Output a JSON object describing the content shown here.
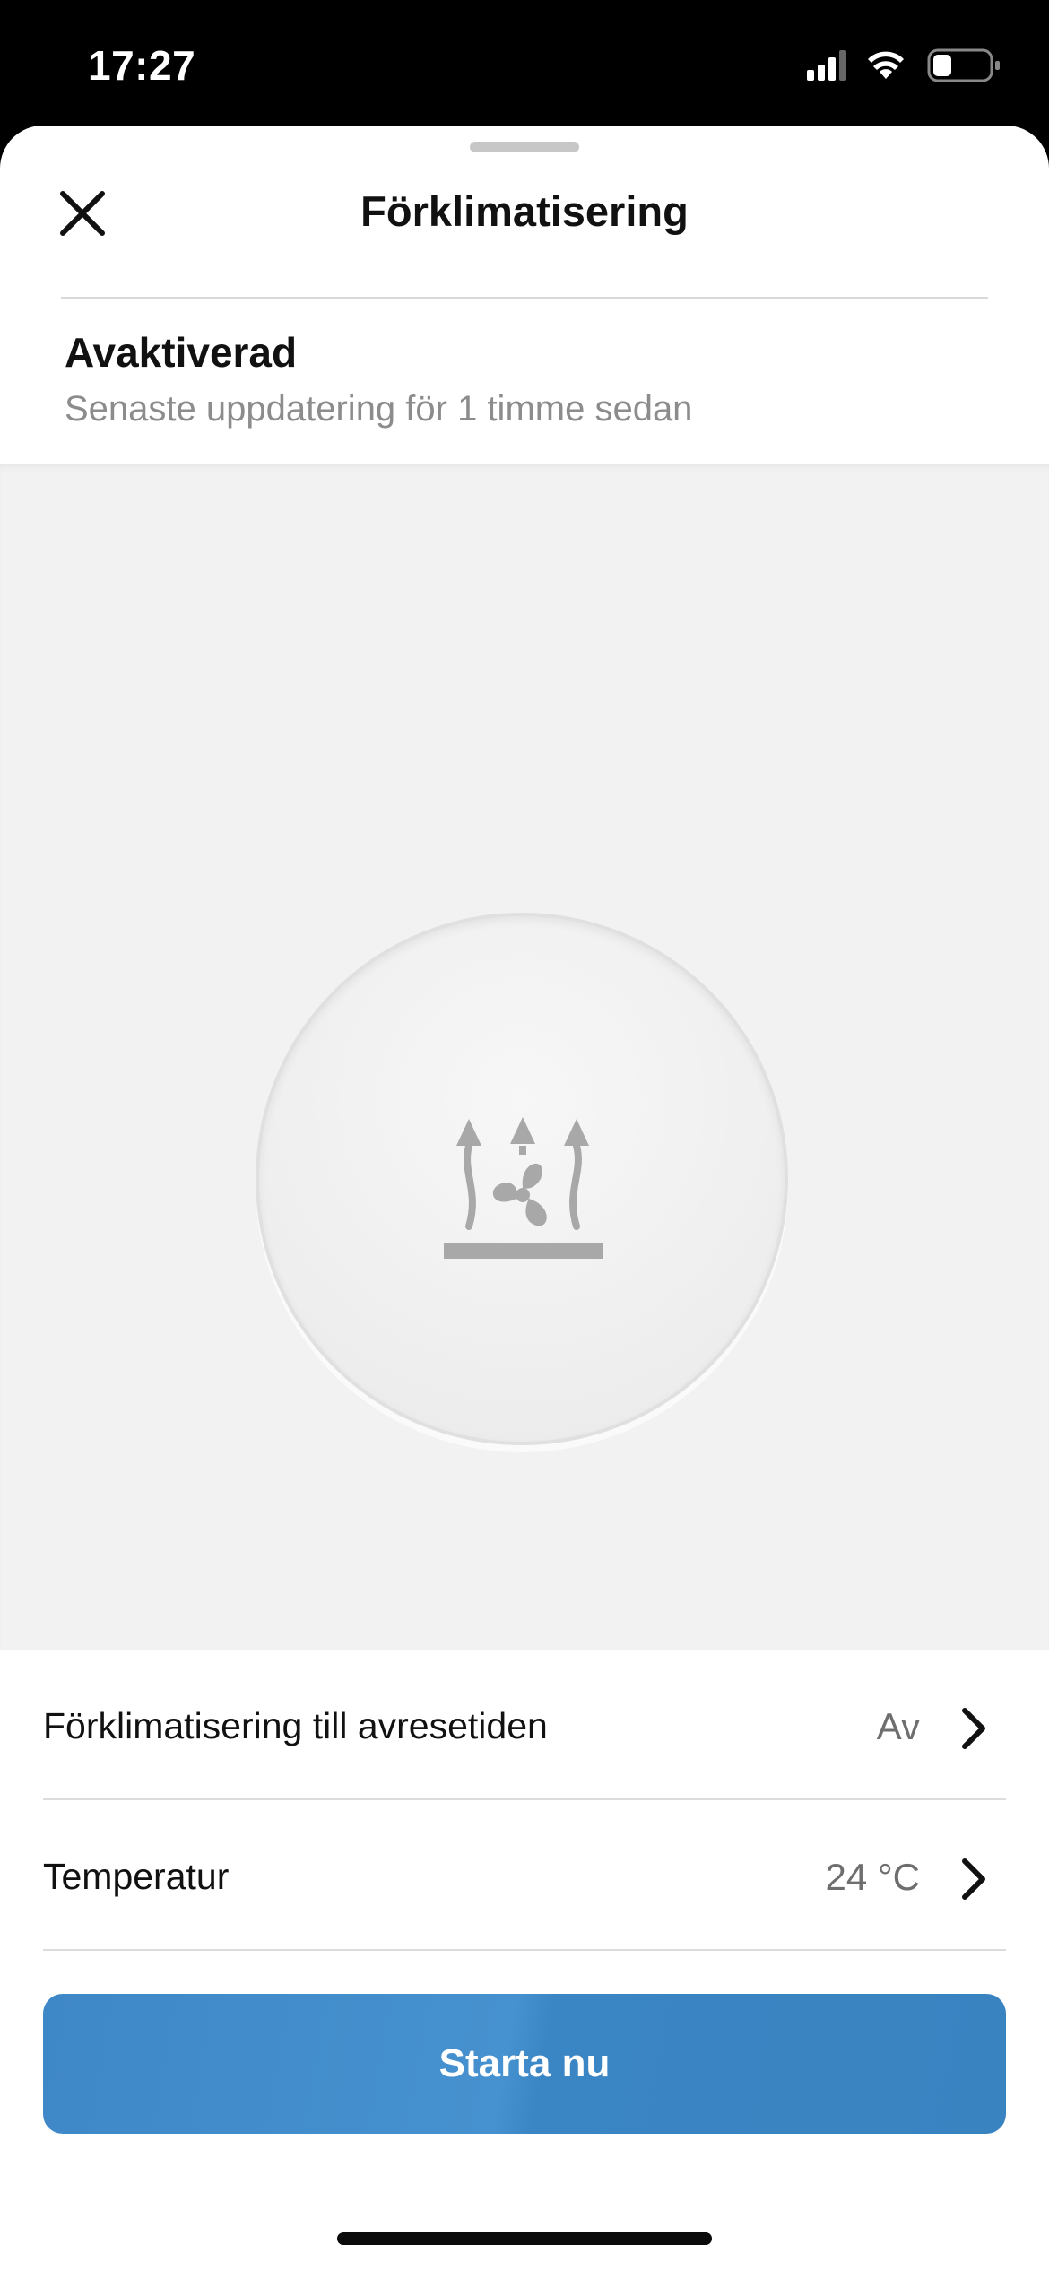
{
  "status_bar": {
    "time": "17:27",
    "icons": [
      "signal-icon",
      "wifi-icon",
      "battery-icon"
    ]
  },
  "header": {
    "title": "Förklimatisering",
    "close_icon": "close-icon"
  },
  "state": {
    "title": "Avaktiverad",
    "subtitle": "Senaste uppdatering för 1 timme sedan"
  },
  "dial": {
    "icon": "fan-heat-icon"
  },
  "settings": [
    {
      "label": "Förklimatisering till avresetiden",
      "value": "Av"
    },
    {
      "label": "Temperatur",
      "value": "24 °C"
    }
  ],
  "primary_button": {
    "label": "Starta nu"
  },
  "colors": {
    "accent": "#3f88c8",
    "stage_bg": "#f2f2f2",
    "icon_gray": "#a8a8a8"
  }
}
